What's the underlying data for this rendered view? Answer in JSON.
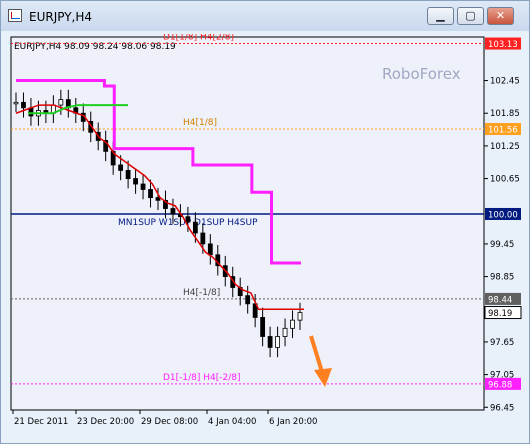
{
  "window": {
    "title": "EURJPY,H4",
    "buttons": {
      "minimize": "▁",
      "maximize": "▢",
      "close": "✕"
    }
  },
  "chart": {
    "info_line": "EURJPY,H4  98.09 98.24 98.06 98.19",
    "watermark": "RoboForex",
    "colors": {
      "background": "#eef0fa",
      "candle": "#000000",
      "red_line": "#e00000",
      "magenta_line": "#ff20ff",
      "green_line": "#20d020",
      "arrow": "#ff8020",
      "level_100": "#001a80"
    },
    "levels": [
      {
        "label": "D1[1/8] H4[2/8]",
        "price": 103.13,
        "price_label": "103.13",
        "color": "#ff2020",
        "style": "dotted",
        "label_color": "#ff2020"
      },
      {
        "label": "H4[1/8]",
        "price": 101.56,
        "price_label": "101.56",
        "color": "#ffa020",
        "style": "dotted",
        "label_color": "#d08000"
      },
      {
        "label": "MN1SUP W1SUP D1SUP H4SUP",
        "price": 100.0,
        "price_label": "100.00",
        "color": "#001a80",
        "style": "solid",
        "label_color": "#001a80"
      },
      {
        "label": "H4[-1/8]",
        "price": 98.44,
        "price_label": "98.44",
        "color": "#606060",
        "style": "dotted",
        "label_color": "#404040"
      },
      {
        "label": "D1[-1/8] H4[-2/8]",
        "price": 96.88,
        "price_label": "96.88",
        "color": "#ff20ff",
        "style": "dotted",
        "label_color": "#ff20ff"
      }
    ],
    "current_price": "98.19",
    "y_ticks": [
      "102.45",
      "101.85",
      "101.25",
      "100.65",
      "99.45",
      "98.85",
      "97.65",
      "97.05",
      "96.45"
    ],
    "x_ticks": [
      "21 Dec 2011",
      "23 Dec 20:00",
      "29 Dec 08:00",
      "4 Jan 04:00",
      "6 Jan 20:00"
    ]
  },
  "chart_data": {
    "type": "line",
    "title": "EURJPY,H4",
    "x_labels": [
      "21 Dec 2011",
      "23 Dec 20:00",
      "29 Dec 08:00",
      "4 Jan 04:00",
      "6 Jan 20:00"
    ],
    "ylim": [
      96.4,
      103.25
    ],
    "series": [
      {
        "values": [
          102.05,
          101.95,
          101.8,
          101.9,
          101.85,
          102.0,
          102.1,
          101.95,
          101.85,
          101.7,
          101.5,
          101.35,
          101.15,
          100.9,
          100.8,
          100.65,
          100.55,
          100.45,
          100.3,
          100.25,
          100.1,
          100.0,
          99.95,
          99.85,
          99.65,
          99.45,
          99.25,
          99.05,
          98.85,
          98.65,
          98.5,
          98.35,
          98.1,
          97.75,
          97.55,
          97.75,
          97.9,
          98.05,
          98.19
        ]
      },
      {
        "values": [
          101.85,
          101.9,
          101.95,
          102.0,
          102.0,
          102.0,
          101.95,
          101.9,
          101.85,
          101.8,
          101.6,
          101.4,
          101.3,
          101.1,
          101.0,
          100.9,
          100.8,
          100.7,
          100.55,
          100.3,
          100.2,
          100.15,
          99.95,
          99.7,
          99.5,
          99.3,
          99.2,
          99.05,
          98.9,
          98.7,
          98.6,
          98.55,
          98.25,
          98.25,
          98.25,
          98.25,
          98.25,
          98.25,
          98.25
        ]
      },
      {
        "values": [
          102.45,
          102.45,
          102.45,
          102.45,
          102.45,
          102.45,
          102.45,
          102.45,
          102.45,
          102.35,
          101.2,
          101.2,
          101.2,
          101.2,
          101.2,
          101.2,
          101.2,
          101.2,
          100.9,
          100.9,
          100.9,
          100.9,
          100.9,
          100.9,
          100.4,
          100.4,
          99.1,
          99.1,
          99.1,
          99.1
        ]
      },
      {
        "values": [
          101.85,
          101.85,
          101.85,
          101.95,
          102.0,
          102.0,
          102.0,
          102.0,
          102.0
        ]
      }
    ]
  }
}
